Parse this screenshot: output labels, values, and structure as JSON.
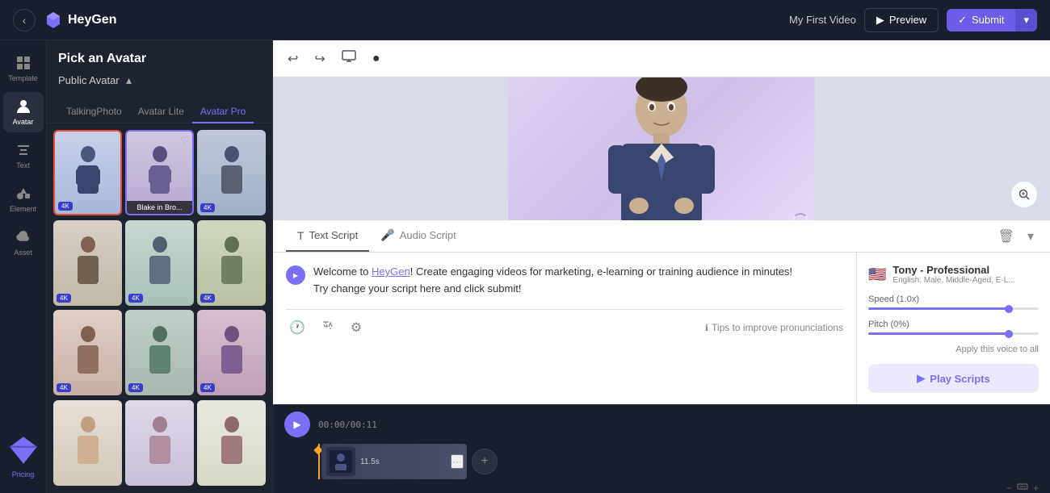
{
  "app": {
    "logo_text": "HeyGen",
    "video_title": "My First Video",
    "back_label": "‹",
    "preview_label": "Preview",
    "submit_label": "Submit"
  },
  "sidebar": {
    "items": [
      {
        "id": "template",
        "label": "Template",
        "icon": "grid"
      },
      {
        "id": "avatar",
        "label": "Avatar",
        "icon": "person",
        "active": true
      },
      {
        "id": "text",
        "label": "Text",
        "icon": "T"
      },
      {
        "id": "element",
        "label": "Element",
        "icon": "shapes"
      },
      {
        "id": "asset",
        "label": "Asset",
        "icon": "cloud"
      },
      {
        "id": "pricing",
        "label": "Pricing",
        "icon": "gem"
      }
    ]
  },
  "avatar_panel": {
    "title": "Pick an Avatar",
    "section_label": "Public Avatar",
    "tabs": [
      {
        "id": "talking",
        "label": "TalkingPhoto"
      },
      {
        "id": "lite",
        "label": "Avatar Lite"
      },
      {
        "id": "pro",
        "label": "Avatar Pro",
        "active": true
      }
    ],
    "avatars": [
      {
        "id": 1,
        "badge": "4K",
        "selected": true,
        "label": ""
      },
      {
        "id": 2,
        "badge": "",
        "selected_blue": true,
        "label": "Blake in Bro...",
        "heart": true
      },
      {
        "id": 3,
        "badge": "4K",
        "selected": false,
        "label": ""
      },
      {
        "id": 4,
        "badge": "4K",
        "selected": false,
        "label": ""
      },
      {
        "id": 5,
        "badge": "4K",
        "selected": false,
        "label": ""
      },
      {
        "id": 6,
        "badge": "4K",
        "selected": false,
        "label": ""
      },
      {
        "id": 7,
        "badge": "4K",
        "selected": false,
        "label": ""
      },
      {
        "id": 8,
        "badge": "4K",
        "selected": false,
        "label": ""
      },
      {
        "id": 9,
        "badge": "4K",
        "selected": false,
        "label": ""
      },
      {
        "id": 10,
        "badge": "",
        "selected": false,
        "label": ""
      },
      {
        "id": 11,
        "badge": "",
        "selected": false,
        "label": ""
      },
      {
        "id": 12,
        "badge": "",
        "selected": false,
        "label": ""
      }
    ]
  },
  "canvas": {
    "toolbar": {
      "undo_label": "↩",
      "redo_label": "↪",
      "monitor_label": "🖥",
      "circle_label": "⬤"
    }
  },
  "script_panel": {
    "tabs": [
      {
        "id": "text",
        "label": "Text Script",
        "active": true
      },
      {
        "id": "audio",
        "label": "Audio Script"
      }
    ],
    "script_text": "Welcome to HeyGen! Create engaging videos for marketing, e-learning or training audience in minutes!\nTry change your script here and click submit!",
    "heygen_link": "HeyGen",
    "apply_voice_label": "Apply this voice to all",
    "tips_label": "Tips to improve pronunciations"
  },
  "voice": {
    "name": "Tony - Professional",
    "description": "English, Male, Middle-Aged, E-L...",
    "speed_label": "Speed (1.0x)",
    "speed_value": 85,
    "pitch_label": "Pitch (0%)",
    "pitch_value": 85,
    "play_scripts_label": "Play Scripts"
  },
  "timeline": {
    "time": "00:00/00:11",
    "clip_duration": "11.5s",
    "add_clip_label": "+"
  }
}
